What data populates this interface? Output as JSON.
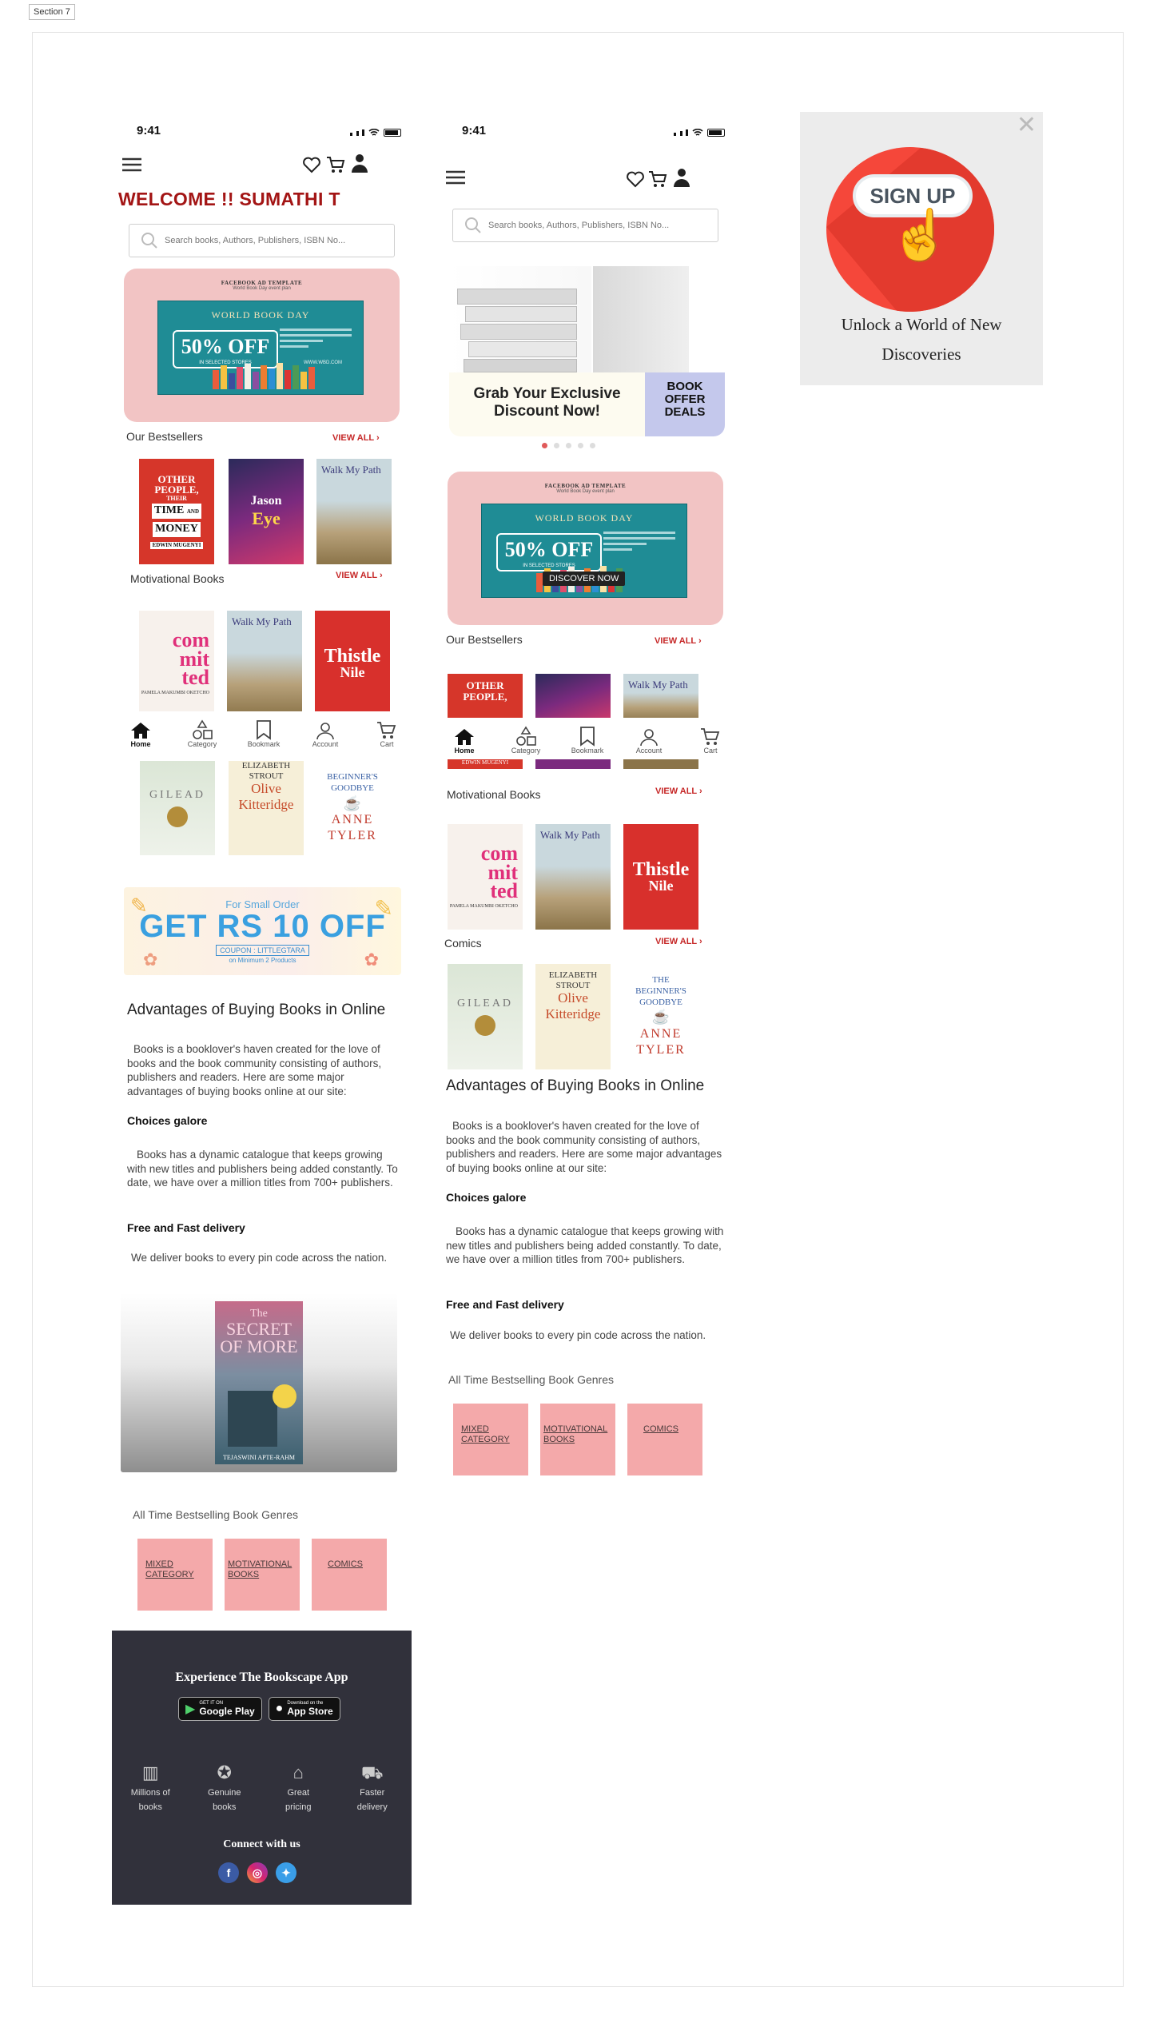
{
  "section_label": "Section 7",
  "status": {
    "time": "9:41"
  },
  "search": {
    "placeholder": "Search books, Authors, Publishers, ISBN No..."
  },
  "phone1": {
    "welcome": "WELCOME !! SUMATHI T",
    "banner": {
      "template": "FACEBOOK AD TEMPLATE",
      "template_sub": "World Book Day event plan",
      "event": "WORLD BOOK DAY",
      "offer": "50% OFF",
      "offer_sub": "IN SELECTED STORES",
      "url": "WWW.WBD.COM"
    },
    "bestsellers_title": "Our Bestsellers",
    "view_all": "VIEW ALL",
    "motivational_title": "Motivational Books",
    "coupon": {
      "small": "For Small Order",
      "big": "GET RS 10 OFF",
      "code": "COUPON : LITTLEGTARA",
      "min": "on Minimum 2 Products"
    },
    "adv_title": "Advantages of Buying Books in Online",
    "adv_para": "Books is a booklover's haven created for the love of books and the book community consisting of authors, publishers and readers. Here are some major advantages of buying books online at our site:",
    "choices_title": "Choices galore",
    "choices_para": "Books has a dynamic catalogue that keeps growing with new titles and publishers being added constantly. To date, we have over a million titles from 700+ publishers.",
    "delivery_title": "Free and Fast delivery",
    "delivery_para": "We deliver books to every pin code across the nation.",
    "featured_book": {
      "title_line1": "The",
      "title_line2": "SECRET",
      "title_line3": "OF MORE",
      "author": "TEJASWINI APTE-RAHM"
    },
    "genres_title": "All Time Bestselling Book Genres",
    "footer": {
      "app_title": "Experience The Bookscape App",
      "google_small": "GET IT ON",
      "google_big": "Google Play",
      "apple_small": "Download on the",
      "apple_big": "App Store",
      "connect": "Connect with us"
    }
  },
  "phone2": {
    "promo": {
      "headline": "Grab Your Exclusive Discount Now!",
      "tag": "BOOK OFFER DEALS"
    },
    "banner_cta": "DISCOVER NOW",
    "bestsellers_title": "Our Bestsellers",
    "motivational_title": "Motivational Books",
    "comics_title": "Comics",
    "view_all": "VIEW ALL"
  },
  "books": {
    "other_people": {
      "line1": "OTHER",
      "line2": "PEOPLE,",
      "line3": "THEIR",
      "line4": "TIME",
      "line5": "AND",
      "line6": "MONEY",
      "author": "EDWIN MUGENYI"
    },
    "jason": {
      "line1": "Jason",
      "line2": "Eye"
    },
    "walk": {
      "title": "Walk My Path"
    },
    "committed": {
      "l1": "com",
      "l2": "mit",
      "l3": "ted",
      "author": "PAMELA MAKUMBI OKETCHO"
    },
    "thistle": {
      "l1": "Thistle",
      "l2": "Nile"
    },
    "gilead": {
      "title": "GILEAD"
    },
    "olive": {
      "author_a": "ELIZABETH",
      "author_b": "STROUT",
      "t1": "Olive",
      "t2": "Kitteridge"
    },
    "tyler": {
      "t1": "THE",
      "t2": "BEGINNER'S",
      "t3": "GOODBYE",
      "a1": "ANNE",
      "a2": "TYLER"
    }
  },
  "genres": [
    {
      "label_a": "MIXED",
      "label_b": "CATEGORY"
    },
    {
      "label_a": "MOTIVATIONAL",
      "label_b": "BOOKS"
    },
    {
      "label_a": "COMICS",
      "label_b": ""
    }
  ],
  "nav": [
    {
      "label": "Home",
      "icon": "home-icon"
    },
    {
      "label": "Category",
      "icon": "category-icon"
    },
    {
      "label": "Bookmark",
      "icon": "bookmark-icon"
    },
    {
      "label": "Account",
      "icon": "account-icon"
    },
    {
      "label": "Cart",
      "icon": "cart-icon"
    }
  ],
  "features": [
    {
      "l1": "Millions of",
      "l2": "books"
    },
    {
      "l1": "Genuine",
      "l2": "books"
    },
    {
      "l1": "Great",
      "l2": "pricing"
    },
    {
      "l1": "Faster",
      "l2": "delivery"
    }
  ],
  "popup": {
    "button": "SIGN UP",
    "line1": "Unlock a World of New",
    "line2": "Discoveries"
  },
  "colors": {
    "welcome": "#a31515",
    "accent": "#c62828",
    "genre_tile": "#f4a9aa",
    "footer_bg": "#31313b",
    "banner_pink": "#f2c4c4",
    "teal": "#1f8c95"
  }
}
